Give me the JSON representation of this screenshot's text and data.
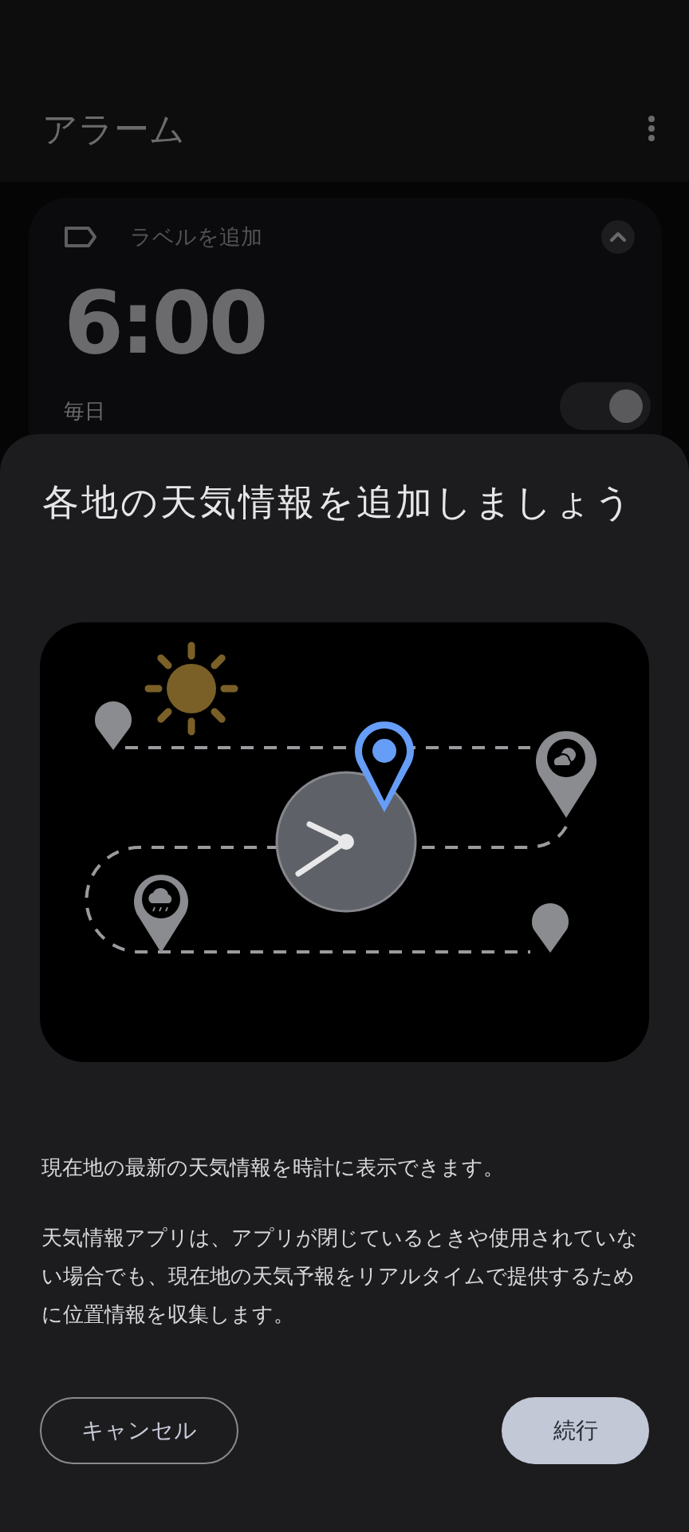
{
  "app_bar": {
    "title": "アラーム"
  },
  "alarm_card": {
    "label_placeholder": "ラベルを追加",
    "expanded": true,
    "time": "6:00",
    "repeat": "毎日",
    "on": true
  },
  "dialog": {
    "title": "各地の天気情報を追加しましょう",
    "paragraphs": [
      "現在地の最新の天気情報を時計に表示できます。",
      "天気情報アプリは、アプリが閉じているときや使用されていない場合でも、現在地の天気予報をリアルタイムで提供するために位置情報を収集します。"
    ],
    "buttons": [
      {
        "label": "キャンセル",
        "kind": "outlined"
      },
      {
        "label": "続行",
        "kind": "filled"
      }
    ]
  }
}
